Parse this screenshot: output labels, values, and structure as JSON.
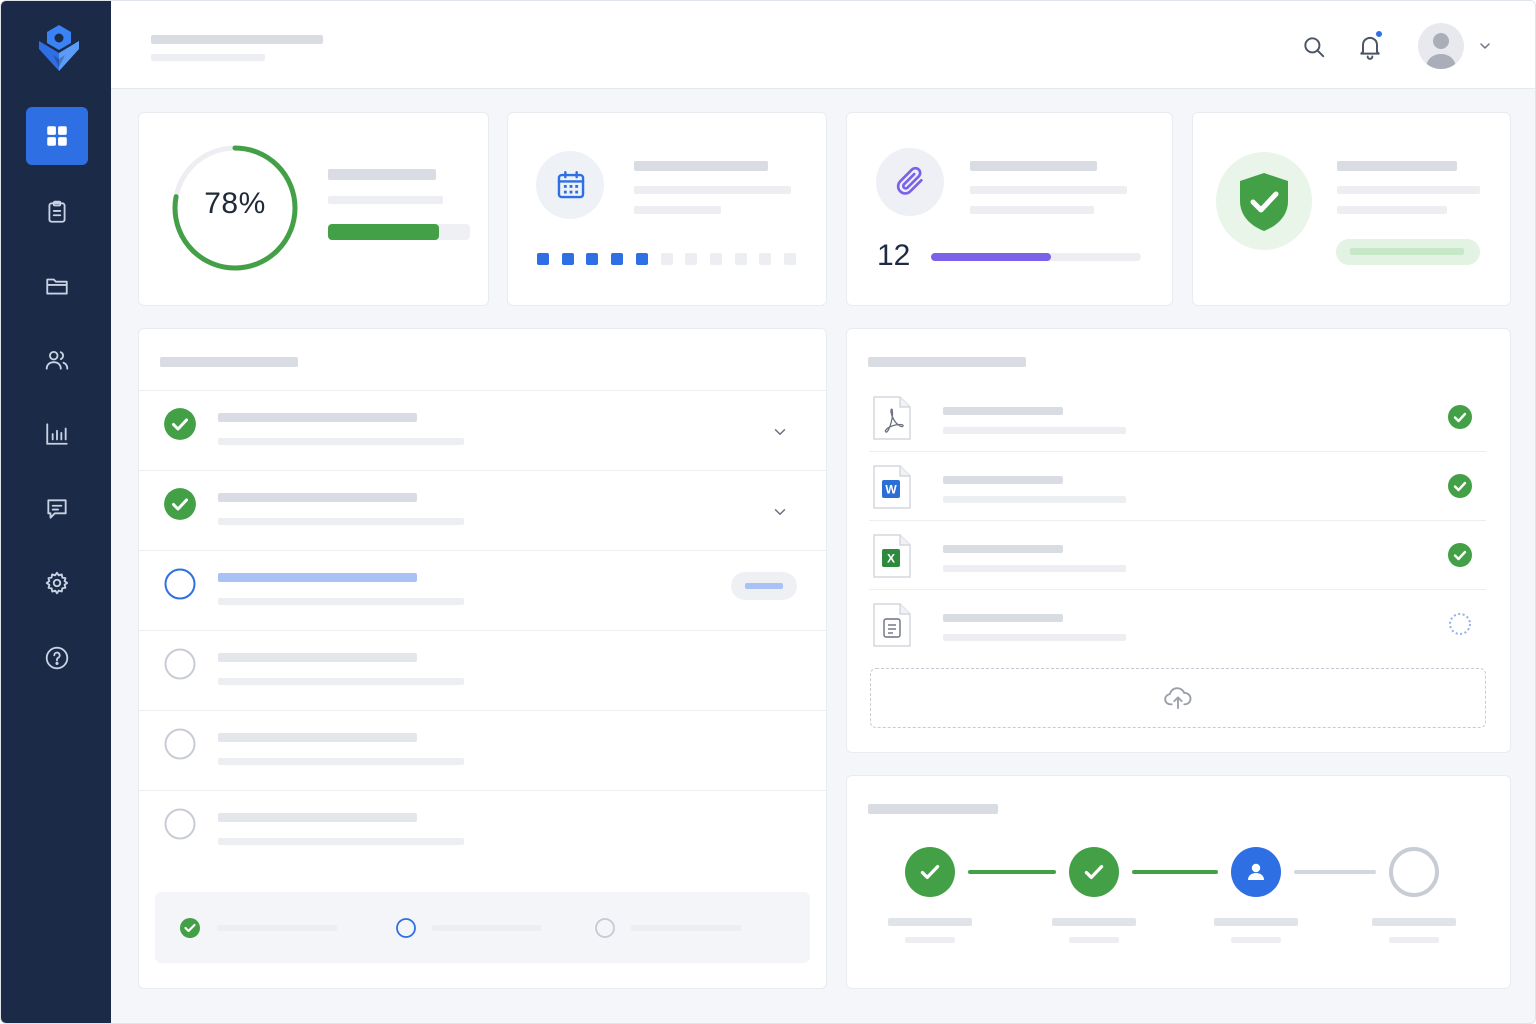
{
  "app": {
    "nav_items": [
      {
        "id": "dashboard",
        "icon": "grid-icon",
        "active": true
      },
      {
        "id": "tasks",
        "icon": "clipboard-icon",
        "active": false
      },
      {
        "id": "files",
        "icon": "folder-icon",
        "active": false
      },
      {
        "id": "users",
        "icon": "users-icon",
        "active": false
      },
      {
        "id": "reports",
        "icon": "bar-chart-icon",
        "active": false
      },
      {
        "id": "messages",
        "icon": "message-icon",
        "active": false
      },
      {
        "id": "settings",
        "icon": "gear-icon",
        "active": false
      },
      {
        "id": "help",
        "icon": "help-icon",
        "active": false
      }
    ]
  },
  "header": {
    "icons": [
      "search-icon",
      "bell-icon",
      "avatar",
      "chevron-down-icon"
    ],
    "notification_dot": true
  },
  "stats": {
    "progress": {
      "label": "78%",
      "value": 0.78,
      "bar_fill": 0.78,
      "color": "#43a047"
    },
    "calendar": {
      "icon": "calendar-icon",
      "filled_days": 5,
      "total_days": 11,
      "color": "#2f6fe4"
    },
    "attachments": {
      "icon": "paperclip-icon",
      "count": "12",
      "bar_fill": 0.57,
      "color": "#7b61e8"
    },
    "security": {
      "icon": "shield-check-icon",
      "status": "verified",
      "color": "#43a047"
    }
  },
  "tasks": {
    "items": [
      {
        "state": "done",
        "expandable": true
      },
      {
        "state": "done",
        "expandable": true
      },
      {
        "state": "active",
        "expandable": false,
        "has_badge": true
      },
      {
        "state": "pending",
        "expandable": false
      },
      {
        "state": "pending",
        "expandable": false
      },
      {
        "state": "pending",
        "expandable": false
      }
    ],
    "legend": [
      "done",
      "active",
      "pending"
    ]
  },
  "files": {
    "items": [
      {
        "type": "pdf-file-icon",
        "status": "done"
      },
      {
        "type": "word-file-icon",
        "badge": "W",
        "status": "done"
      },
      {
        "type": "excel-file-icon",
        "badge": "X",
        "status": "done"
      },
      {
        "type": "document-file-icon",
        "status": "loading"
      }
    ],
    "upload_icon": "cloud-upload-icon"
  },
  "steps": {
    "items": [
      {
        "state": "done"
      },
      {
        "state": "done"
      },
      {
        "state": "current"
      },
      {
        "state": "pending"
      }
    ]
  },
  "colors": {
    "sidebar": "#1b2a47",
    "accent": "#2f6fe4",
    "success": "#43a047",
    "purple": "#7b61e8"
  }
}
